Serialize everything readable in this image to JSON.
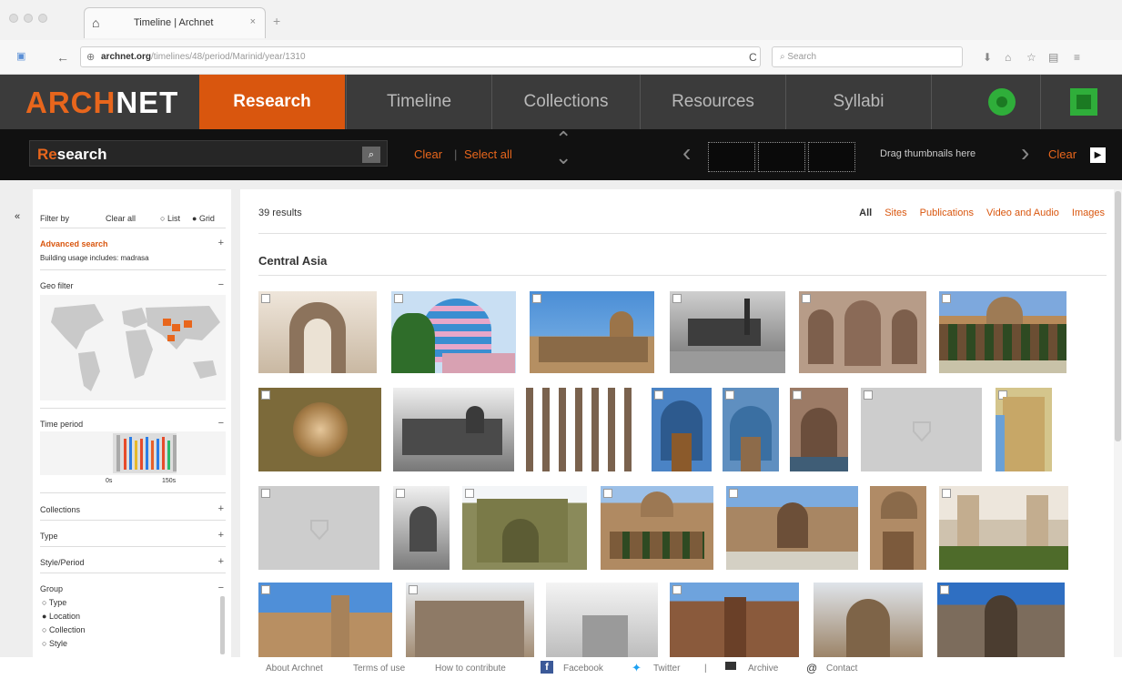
{
  "browser": {
    "tab_title": "Timeline | Archnet",
    "url_domain": "archnet.org",
    "url_path": "/timelines/48/period/Marinid/year/1310",
    "search_placeholder": "Search"
  },
  "header": {
    "logo_part1": "ARCH",
    "logo_part2": "NET",
    "tabs": [
      "Research",
      "Timeline",
      "Collections",
      "Resources",
      "Syllabi"
    ],
    "accent_color": "#d9560e"
  },
  "subbar": {
    "search_prefix": "Re",
    "search_rest": "search",
    "clear_label": "Clear",
    "select_all_label": "Select all",
    "drag_label": "Drag thumbnails here",
    "clear_right_label": "Clear"
  },
  "sidebar": {
    "filter_by": "Filter by",
    "clear_all": "Clear all",
    "list": "List",
    "grid": "Grid",
    "advanced_search": "Advanced search",
    "building_usage": "Building usage includes: madrasa",
    "geo_filter": "Geo filter",
    "time_period": "Time period",
    "time_start": "0s",
    "time_end": "150s",
    "collections": "Collections",
    "type": "Type",
    "style_period": "Style/Period",
    "group": "Group",
    "group_options": [
      "Type",
      "Location",
      "Collection",
      "Style"
    ]
  },
  "main": {
    "results": "39 results",
    "filters": [
      "All",
      "Sites",
      "Publications",
      "Video and Audio",
      "Images"
    ],
    "region": "Central Asia"
  },
  "footer": {
    "about": "About Archnet",
    "terms": "Terms of use",
    "contribute": "How to contribute",
    "facebook": "Facebook",
    "twitter": "Twitter",
    "separator": "|",
    "archive": "Archive",
    "contact": "Contact"
  }
}
